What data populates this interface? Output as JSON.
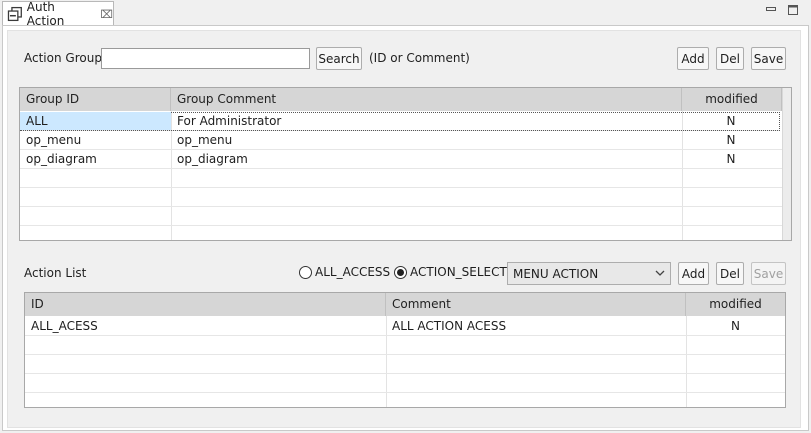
{
  "tab": {
    "title": "Auth Action",
    "close_glyph": "⌧"
  },
  "group_section": {
    "search_label": "Action Group",
    "search_value": "",
    "search_button": "Search",
    "hint": "(ID  or Comment)",
    "add_button": "Add",
    "del_button": "Del",
    "save_button": "Save",
    "columns": [
      "Group ID",
      "Group Comment",
      "modified"
    ],
    "rows": [
      {
        "id": "ALL",
        "comment": "For Administrator",
        "modified": "N",
        "selected": true
      },
      {
        "id": "op_menu",
        "comment": "op_menu",
        "modified": "N"
      },
      {
        "id": "op_diagram",
        "comment": "op_diagram",
        "modified": "N"
      }
    ]
  },
  "action_section": {
    "label": "Action List",
    "radio_all_label": "ALL_ACCESS",
    "radio_select_label": "ACTION_SELECT",
    "selected_radio": "ACTION_SELECT",
    "combo_value": "MENU ACTION",
    "add_button": "Add",
    "del_button": "Del",
    "save_button": "Save",
    "columns": [
      "ID",
      "Comment",
      "modified"
    ],
    "rows": [
      {
        "id": "ALL_ACESS",
        "comment": "ALL ACTION ACESS",
        "modified": "N"
      }
    ]
  },
  "colors": {
    "header_bg": "#d6d6d6",
    "selection": "#cce8ff",
    "panel_bg": "#f0f0f0"
  }
}
